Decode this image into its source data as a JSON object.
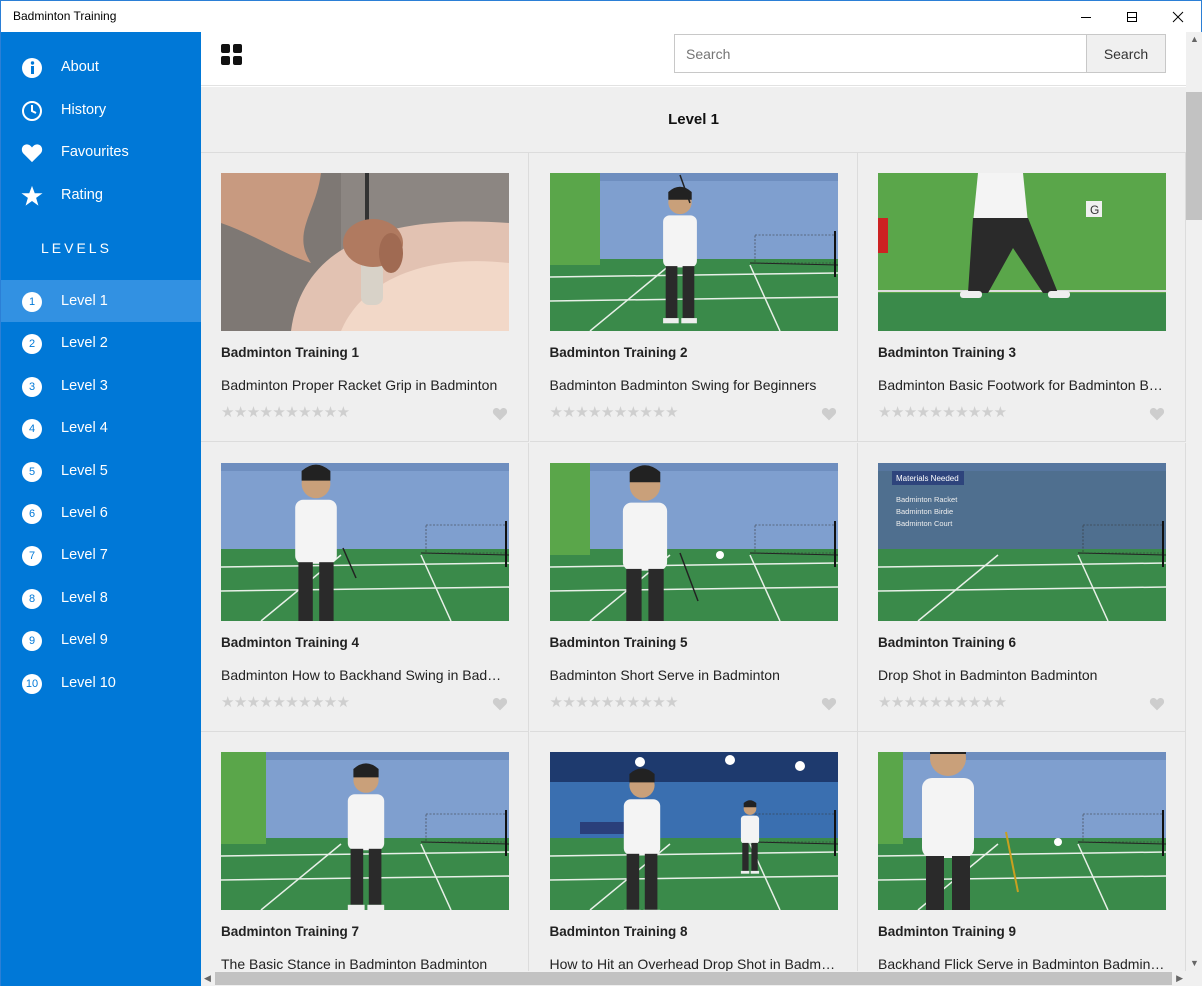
{
  "window": {
    "title": "Badminton Training"
  },
  "sidebar": {
    "menu": [
      {
        "label": "About",
        "icon": "info-icon"
      },
      {
        "label": "History",
        "icon": "clock-icon"
      },
      {
        "label": "Favourites",
        "icon": "heart-icon"
      },
      {
        "label": "Rating",
        "icon": "star-icon"
      }
    ],
    "levels_heading": "LEVELS",
    "levels": [
      {
        "num": "1",
        "label": "Level 1",
        "active": true
      },
      {
        "num": "2",
        "label": "Level 2"
      },
      {
        "num": "3",
        "label": "Level 3"
      },
      {
        "num": "4",
        "label": "Level 4"
      },
      {
        "num": "5",
        "label": "Level 5"
      },
      {
        "num": "6",
        "label": "Level 6"
      },
      {
        "num": "7",
        "label": "Level 7"
      },
      {
        "num": "8",
        "label": "Level 8"
      },
      {
        "num": "9",
        "label": "Level 9"
      },
      {
        "num": "10",
        "label": "Level 10"
      }
    ]
  },
  "search": {
    "placeholder": "Search",
    "value": "",
    "button_label": "Search"
  },
  "main": {
    "heading": "Level 1",
    "videos": [
      {
        "title": "Badminton Training 1",
        "description": "Badminton Proper Racket Grip in Badminton",
        "stars": "★★★★★★★★★★",
        "thumb": "racket-grip-closeup"
      },
      {
        "title": "Badminton Training 2",
        "description": "Badminton Badminton Swing for Beginners",
        "stars": "★★★★★★★★★★",
        "thumb": "court-swing"
      },
      {
        "title": "Badminton Training 3",
        "description": "Badminton Basic Footwork for Badminton B…",
        "stars": "★★★★★★★★★★",
        "thumb": "footwork-green-wall"
      },
      {
        "title": "Badminton Training 4",
        "description": "Badminton How to Backhand Swing in Bad…",
        "stars": "★★★★★★★★★★",
        "thumb": "court-backhand"
      },
      {
        "title": "Badminton Training 5",
        "description": "Badminton Short Serve in Badminton",
        "stars": "★★★★★★★★★★",
        "thumb": "court-serve"
      },
      {
        "title": "Badminton Training 6",
        "description": "Drop Shot in Badminton Badminton",
        "stars": "★★★★★★★★★★",
        "thumb": "court-materials",
        "overlay": {
          "heading": "Materials Needed",
          "items": [
            "Badminton Racket",
            "Badminton Birdie",
            "Badminton Court"
          ]
        }
      },
      {
        "title": "Badminton Training 7",
        "description": "The Basic Stance in Badminton Badminton",
        "stars": "★★★★★★★★★★",
        "thumb": "court-stance"
      },
      {
        "title": "Badminton Training 8",
        "description": "How to Hit an Overhead Drop Shot in Badm…",
        "stars": "★★★★★★★★★★",
        "thumb": "court-overhead"
      },
      {
        "title": "Badminton Training 9",
        "description": "Backhand Flick Serve in Badminton Badmin…",
        "stars": "★★★★★★★★★★",
        "thumb": "court-flick"
      }
    ]
  },
  "colors": {
    "sidebar": "#0078d7",
    "sidebar_active": "#3291e2",
    "content_bg": "#efefef",
    "court_green": "#3a8a4a",
    "wall_blue": "#7f9fcf",
    "wall_green": "#5aa64a"
  }
}
